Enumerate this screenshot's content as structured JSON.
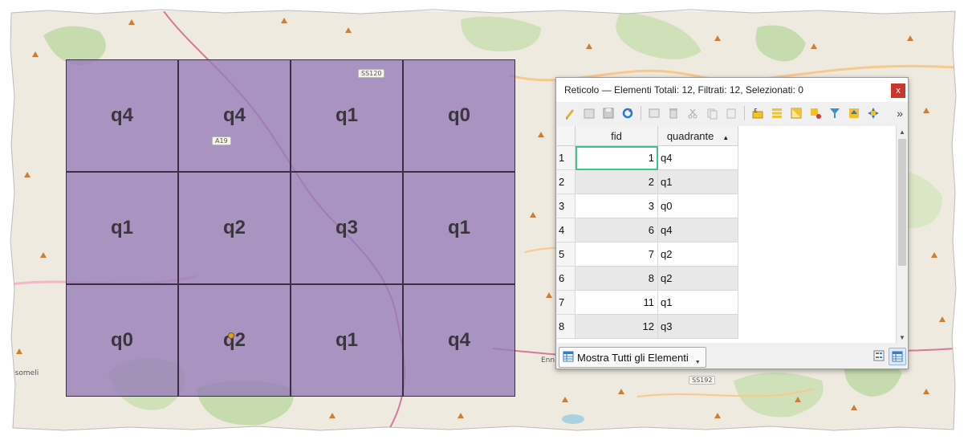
{
  "map": {
    "grid_labels": [
      "q4",
      "q4",
      "q1",
      "q0",
      "q1",
      "q2",
      "q3",
      "q1",
      "q0",
      "q2",
      "q1",
      "q4"
    ],
    "place_labels": {
      "left_town": "ssomeli",
      "right_town": "Enn"
    },
    "road_labels": {
      "top": "SS120",
      "mid": "A19",
      "bottom": "SS192"
    }
  },
  "dialog": {
    "title": "Reticolo — Elementi Totali: 12, Filtrati: 12, Selezionati: 0",
    "close_label": "x",
    "more_label": "»",
    "columns": [
      "fid",
      "quadrante"
    ],
    "sort_indicator": "▲",
    "rows": [
      {
        "n": "1",
        "fid": "1",
        "q": "q4"
      },
      {
        "n": "2",
        "fid": "2",
        "q": "q1"
      },
      {
        "n": "3",
        "fid": "3",
        "q": "q0"
      },
      {
        "n": "4",
        "fid": "6",
        "q": "q4"
      },
      {
        "n": "5",
        "fid": "7",
        "q": "q2"
      },
      {
        "n": "6",
        "fid": "8",
        "q": "q2"
      },
      {
        "n": "7",
        "fid": "11",
        "q": "q1"
      },
      {
        "n": "8",
        "fid": "12",
        "q": "q3"
      }
    ],
    "show_all_label": "Mostra Tutti gli Elementi"
  },
  "colors": {
    "grid_fill": "#967db9",
    "accent_close": "#c8362c",
    "active_cell": "#43c28a"
  }
}
